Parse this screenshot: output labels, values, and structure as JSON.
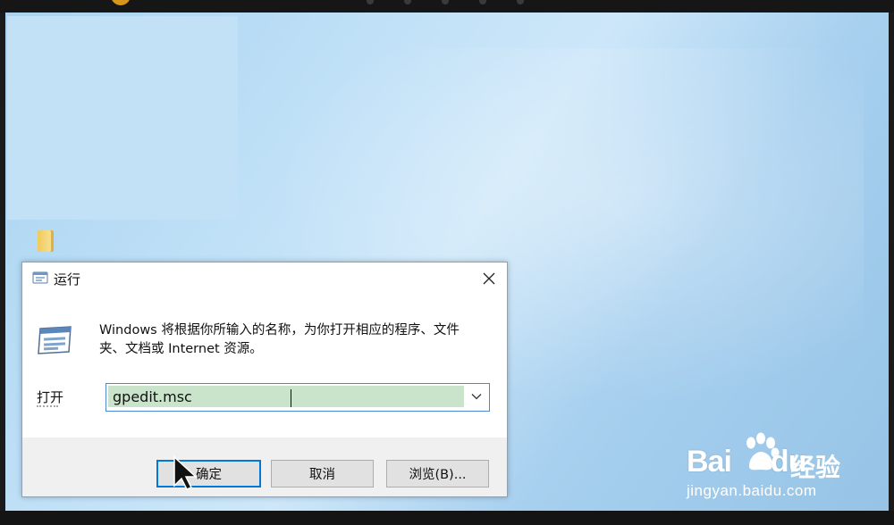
{
  "dialog": {
    "title": "运行",
    "description": "Windows 将根据你所输入的名称，为你打开相应的程序、文件夹、文档或 Internet 资源。",
    "description_line1": "Windows 将根据你所输入的名称，为你打开相应的程序、文件",
    "description_line2": "夹、文档或 Internet 资源。",
    "open_label": "打开",
    "input_value": "gpedit.msc",
    "buttons": {
      "ok": "确定",
      "cancel": "取消",
      "browse": "浏览(B)..."
    }
  },
  "watermark": {
    "brand": "Bai",
    "brand_tail": "du",
    "suffix": "经验",
    "url": "jingyan.baidu.com"
  },
  "icons": {
    "title": "run-icon",
    "close": "close-icon",
    "dropdown": "chevron-down-icon",
    "cursor": "mouse-pointer-icon",
    "desktop": "folder-icon"
  },
  "colors": {
    "accent": "#0078d7",
    "input_highlight": "#c9e4cb",
    "desktop": "#bfe0f7"
  }
}
